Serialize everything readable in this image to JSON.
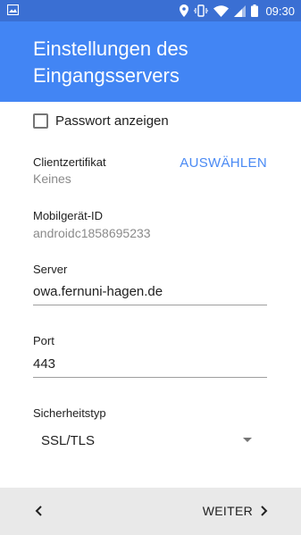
{
  "status": {
    "time": "09:30"
  },
  "appbar": {
    "title": "Einstellungen des Eingangsservers"
  },
  "form": {
    "show_password_label": "Passwort anzeigen",
    "client_cert_label": "Clientzertifikat",
    "client_cert_value": "Keines",
    "client_cert_action": "AUSWÄHLEN",
    "device_id_label": "Mobilgerät-ID",
    "device_id_value": "androidc1858695233",
    "server_label": "Server",
    "server_value": "owa.fernuni-hagen.de",
    "port_label": "Port",
    "port_value": "443",
    "security_label": "Sicherheitstyp",
    "security_value": "SSL/TLS"
  },
  "nav": {
    "next_label": "WEITER"
  },
  "icons": [
    "image-icon",
    "location-icon",
    "vibrate-icon",
    "wifi-icon",
    "signal-icon",
    "battery-icon",
    "chevron-left-icon",
    "chevron-right-icon",
    "dropdown-arrow-icon"
  ],
  "colors": {
    "status_bar": "#3a6fd3",
    "app_bar": "#4285f4",
    "accent": "#4a8af4",
    "bottom_bar": "#e9e9e9"
  }
}
